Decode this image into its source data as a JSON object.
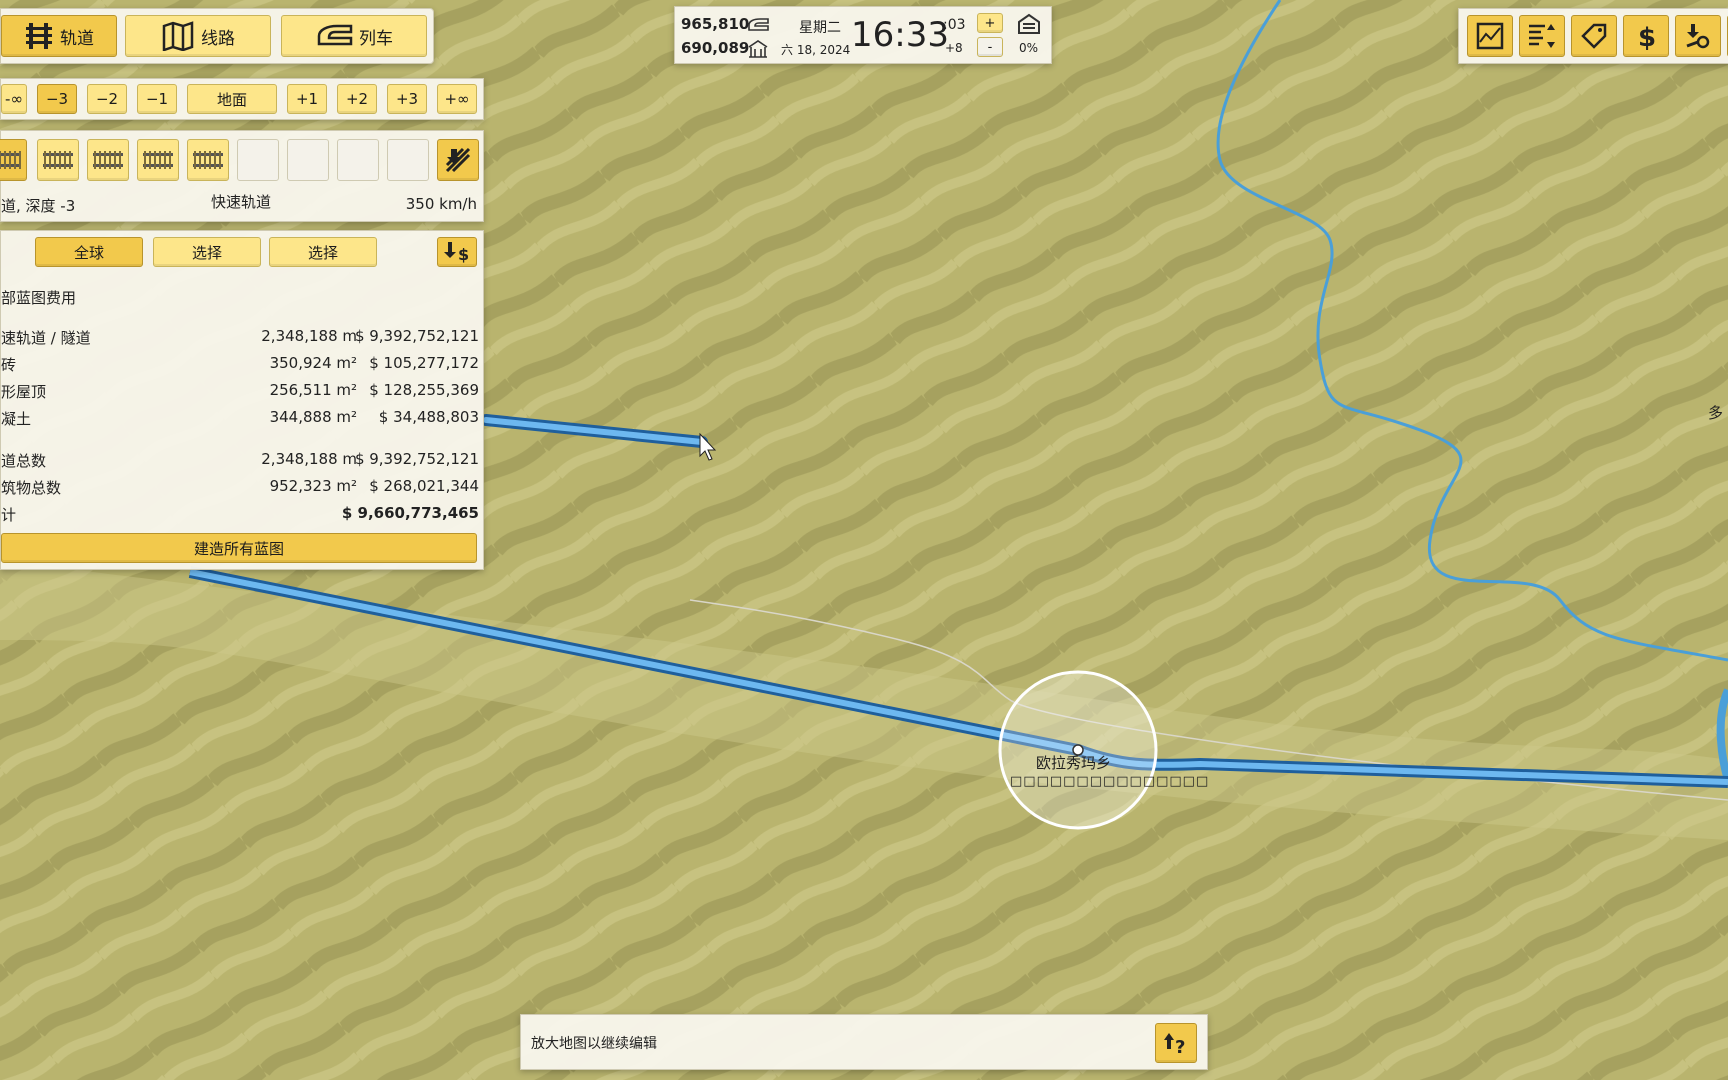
{
  "mode_tabs": [
    {
      "label": "轨道",
      "icon": "track-icon",
      "active": true
    },
    {
      "label": "线路",
      "icon": "route-map-icon",
      "active": false
    },
    {
      "label": "列车",
      "icon": "train-icon",
      "active": false
    }
  ],
  "depth_levels": [
    "-∞",
    "−3",
    "−2",
    "−1",
    "地面",
    "+1",
    "+2",
    "+3",
    "+∞"
  ],
  "depth_active": "−3",
  "track": {
    "description": "道, 深度 -3",
    "type_name": "快速轨道",
    "speed": "350 km/h",
    "tile_icons": [
      "track-segment-icon",
      "track-segment-icon",
      "track-segment-icon",
      "track-segment-icon",
      "track-segment-icon"
    ],
    "tool_icon": "demolish-track-icon"
  },
  "cost_panel": {
    "tabs": [
      "全球",
      "选择",
      "选择"
    ],
    "active_tab": "全球",
    "icon": "sell-blueprint-icon",
    "title": "部蓝图费用",
    "rows": [
      {
        "label": "速轨道 / 隧道",
        "qty": "2,348,188 m",
        "cost": "$ 9,392,752,121"
      },
      {
        "label": "砖",
        "qty": "350,924 m²",
        "cost": "$ 105,277,172"
      },
      {
        "label": "形屋顶",
        "qty": "256,511 m²",
        "cost": "$ 128,255,369"
      },
      {
        "label": "凝土",
        "qty": "344,888 m²",
        "cost": "$ 34,488,803"
      }
    ],
    "totals": [
      {
        "label": "道总数",
        "qty": "2,348,188 m",
        "cost": "$ 9,392,752,121"
      },
      {
        "label": "筑物总数",
        "qty": "952,323 m²",
        "cost": "$ 268,021,344"
      }
    ],
    "grand_total_label": "计",
    "grand_total": "$ 9,660,773,465",
    "build_all": "建造所有蓝图"
  },
  "status": {
    "passengers_a": "965,810",
    "passengers_b": "690,089",
    "weekday": "星期二",
    "date": "六 18, 2024",
    "time": "16:33",
    "seconds": ":03",
    "speed_offset": "+8",
    "plus": "+",
    "minus": "-",
    "percent": "0%"
  },
  "toolbar_icons": [
    "map-overview-icon",
    "sort-list-icon",
    "price-tag-icon",
    "money-icon",
    "key-icon",
    "search-icon"
  ],
  "map": {
    "station_name": "欧拉秀玛乡",
    "station_subtitle": "□□□□□□□□□□□□□□□",
    "edge_label": "多",
    "colors": {
      "terrain": "#b7b26c",
      "track": "#3b8fd6",
      "river": "#4a9fd8"
    }
  },
  "hint": {
    "text": "放大地图以继续编辑",
    "icon": "help-icon"
  }
}
